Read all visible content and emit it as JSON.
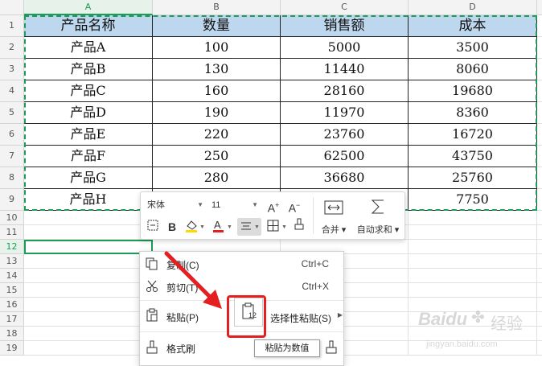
{
  "columns": [
    "A",
    "B",
    "C",
    "D"
  ],
  "rows": [
    "1",
    "2",
    "3",
    "4",
    "5",
    "6",
    "7",
    "8",
    "9",
    "10",
    "11",
    "12",
    "13",
    "14",
    "15",
    "16",
    "17",
    "18",
    "19"
  ],
  "table": {
    "headers": [
      "产品名称",
      "数量",
      "销售额",
      "成本"
    ],
    "body": [
      [
        "产品A",
        "100",
        "5000",
        "3500"
      ],
      [
        "产品B",
        "130",
        "11440",
        "8060"
      ],
      [
        "产品C",
        "160",
        "28160",
        "19680"
      ],
      [
        "产品D",
        "190",
        "11970",
        "8360"
      ],
      [
        "产品E",
        "220",
        "23760",
        "16720"
      ],
      [
        "产品F",
        "250",
        "62500",
        "43750"
      ],
      [
        "产品G",
        "280",
        "36680",
        "25760"
      ],
      [
        "产品H",
        "",
        "",
        "7750"
      ]
    ]
  },
  "colors": {
    "header_fill": "#bdd7ee",
    "selection": "#1e9b58",
    "arrow": "#e41f1f"
  },
  "mini_toolbar": {
    "font_name": "宋体",
    "font_size": "11",
    "merge_label": "合并",
    "autosum_label": "自动求和"
  },
  "context_menu": {
    "copy": {
      "label": "复制(C)",
      "shortcut": "Ctrl+C"
    },
    "cut": {
      "label": "剪切(T)",
      "shortcut": "Ctrl+X"
    },
    "paste": {
      "label": "粘贴(P)"
    },
    "paste_special": {
      "label": "选择性粘贴(S)"
    },
    "format_painter": {
      "label": "格式刷"
    },
    "paste_values_icon_text": "12"
  },
  "tooltip": "粘贴为数值",
  "watermark": {
    "brand": "Baidu",
    "suffix": "经验",
    "url": "jingyan.baidu.com"
  }
}
